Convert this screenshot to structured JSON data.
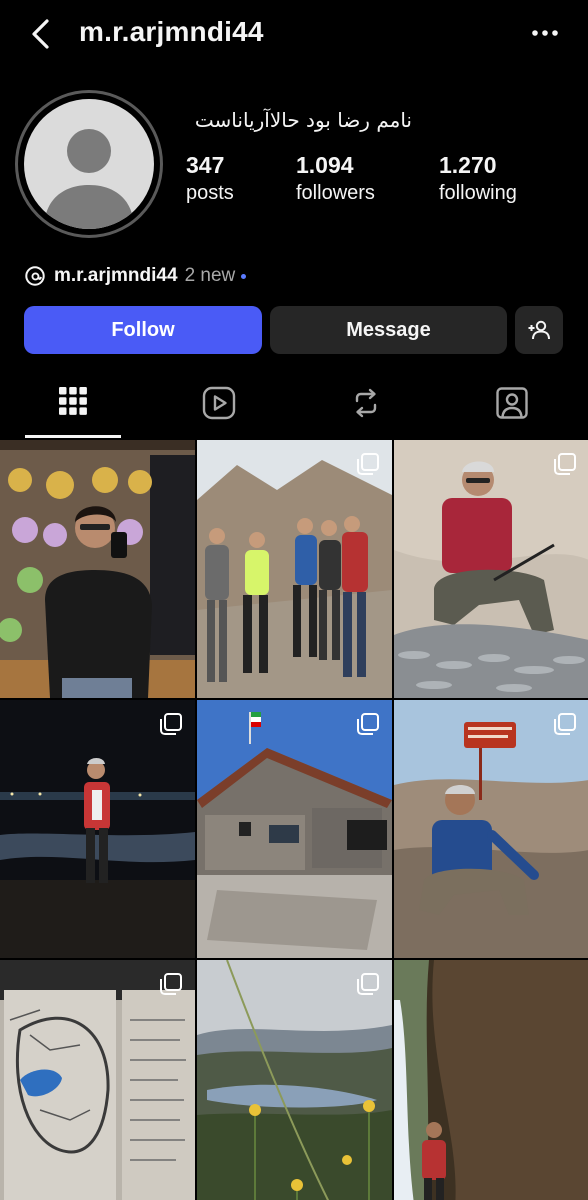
{
  "header": {
    "username": "m.r.arjmndi44"
  },
  "profile": {
    "bio_name": "نامم رضا بود حالاآریاناست",
    "stats": [
      {
        "value": "347",
        "label": "posts"
      },
      {
        "value": "1.094",
        "label": "followers"
      },
      {
        "value": "1.270",
        "label": "following"
      }
    ],
    "threads": {
      "handle": "m.r.arjmndi44",
      "badge": "2 new"
    }
  },
  "actions": {
    "follow": "Follow",
    "message": "Message"
  },
  "tabs": [
    "grid-icon",
    "reels-icon",
    "reposts-icon",
    "tagged-icon"
  ],
  "colors": {
    "accent": "#4a5bf6",
    "background": "#000000",
    "button": "#262626"
  },
  "grid": [
    {
      "scene": "selfie in toy shop",
      "multi": false
    },
    {
      "scene": "hikers on mountain",
      "multi": true
    },
    {
      "scene": "fishing catch on rocks",
      "multi": true
    },
    {
      "scene": "man at night beach",
      "multi": true
    },
    {
      "scene": "stone mountain hut with flag",
      "multi": true
    },
    {
      "scene": "man at summit sign",
      "multi": true
    },
    {
      "scene": "hand-drawn map on stone",
      "multi": true
    },
    {
      "scene": "lake valley with yellow flowers",
      "multi": true
    },
    {
      "scene": "man at waterfall",
      "multi": false
    }
  ]
}
